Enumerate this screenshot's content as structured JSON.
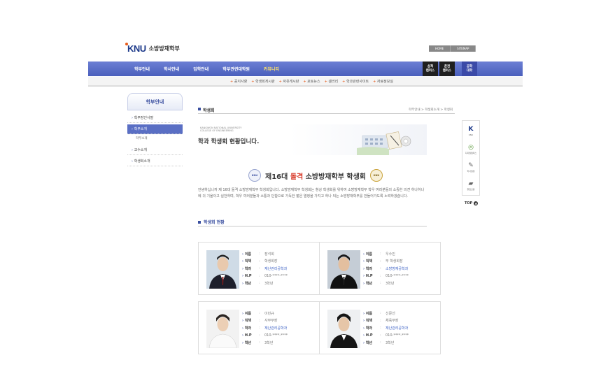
{
  "header": {
    "logo_mark": "KNU",
    "logo_text": "소방방재학부",
    "top_links": [
      "HOME",
      "SITEMAP"
    ]
  },
  "gnb": {
    "items": [
      "학부안내",
      "학사안내",
      "입학안내",
      "학부관련대학원",
      "커뮤니티"
    ],
    "active_index": 4,
    "campus": [
      "삼척\n캠퍼스",
      "춘천\n캠퍼스",
      "공학\n대학"
    ]
  },
  "subnav": [
    "공지사항",
    "학생회게시판",
    "자유게시판",
    "포토뉴스",
    "갤러리",
    "학과관련사이트",
    "자료정보실"
  ],
  "lnb": {
    "title": "학부안내",
    "items": [
      "학부장인사말",
      "학부소개",
      "교수소개",
      "학생회소개"
    ],
    "sub_item": "학부소개"
  },
  "page": {
    "title": "학생회",
    "breadcrumb": "학부안내 > 학생회소개 > 학생회"
  },
  "banner": {
    "small_line1": "KANGWON NATIONAL UNIVERSITY",
    "small_line2": "COLLEGE OF ENGINEERING",
    "main": "학과 학생회 현황입니다."
  },
  "council": {
    "emblem_left": "KNU",
    "emblem_right": "KNU",
    "prefix": "제16대 ",
    "highlight": "돌격",
    "suffix": " 소방방재학부 학생회"
  },
  "intro": "안녕하십니까 제 16대 돌격 소방방재학부 학생회입니다. 소방방재학부 학생회는 항상 학생회를 위하여 소방방재학부 학우 여러분들의 소중한 의견 하나하나에 귀 기울이고 실천하며, 학우 여러분들과 소통과 단합으로 가득한 젊은 열정을 가지고 하나 되는 소방방재학부를 만들어가도록 노력하겠습니다.",
  "section_title": "학생회 현황",
  "field_labels": [
    "이름",
    "직책",
    "학과",
    "H.P",
    "학년"
  ],
  "members": [
    {
      "name": "장석희",
      "role": "학생회장",
      "dept": "재난관리공학과",
      "hp": "010-****-****",
      "year": "3학년"
    },
    {
      "name": "우수민",
      "role": "부 학생회장",
      "dept": "소방방재공학과",
      "hp": "010-****-****",
      "year": "3학년"
    },
    {
      "name": "이민규",
      "role": "사무부장",
      "dept": "재난관리공학과",
      "hp": "010-****-****",
      "year": "3학년"
    },
    {
      "name": "신문선",
      "role": "체육부장",
      "dept": "재난관리공학과",
      "hp": "010-****-****",
      "year": "3학년"
    }
  ],
  "quick": {
    "items": [
      "KNU",
      "디지털캠퍼스",
      "학사일정",
      "졸업인증"
    ],
    "top_label": "TOP"
  }
}
